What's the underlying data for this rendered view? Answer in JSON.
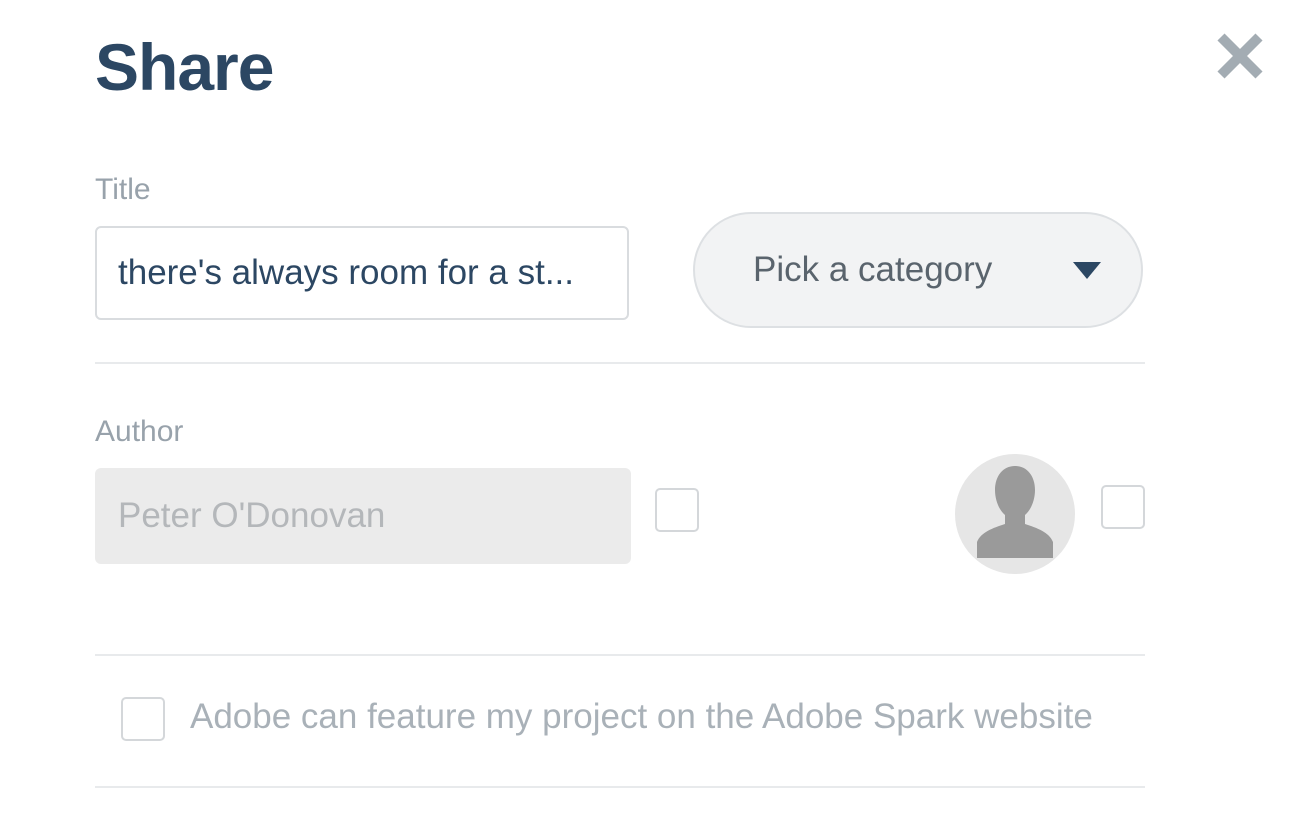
{
  "dialog": {
    "title": "Share",
    "close_icon": "close-icon"
  },
  "title_field": {
    "label": "Title",
    "value": "there's always room for a st..."
  },
  "category": {
    "selected": "Pick a category",
    "icon": "caret-down-icon"
  },
  "author_field": {
    "label": "Author",
    "value": "Peter O'Donovan",
    "show_name_checked": false,
    "show_avatar_checked": false,
    "avatar_icon": "user-silhouette-icon"
  },
  "feature": {
    "label": "Adobe can feature my project on the Adobe Spark website",
    "checked": false
  },
  "colors": {
    "title_text": "#2c4763",
    "label_text": "#98a2ab",
    "close_icon": "#a3acb3",
    "select_background": "#f2f3f4",
    "disabled_input": "#ebebeb"
  }
}
